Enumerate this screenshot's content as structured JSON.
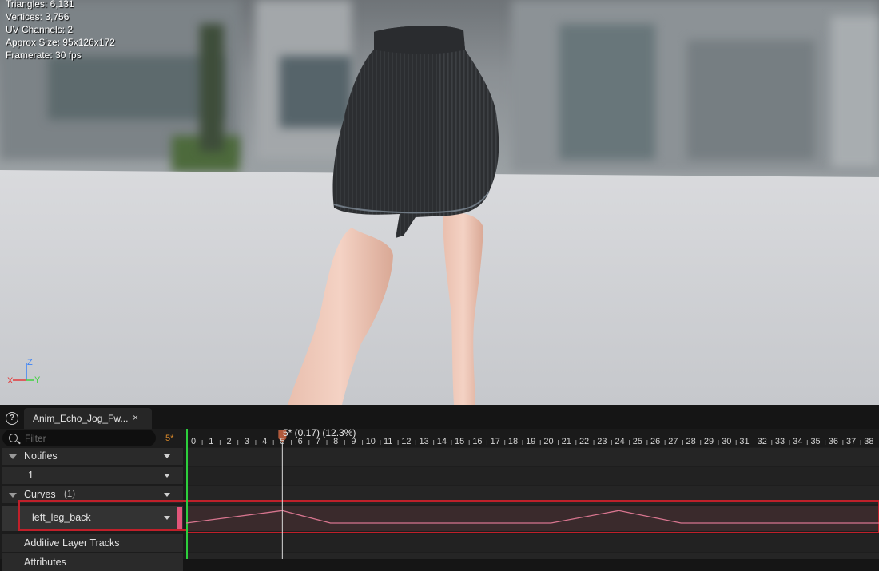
{
  "viewport": {
    "stats": [
      "Triangles: 6,131",
      "Vertices: 3,756",
      "UV Channels: 2",
      "Approx Size: 95x126x172",
      "Framerate: 30 fps"
    ],
    "axis": {
      "z": "Z",
      "y": "Y",
      "x": "X",
      "z_color": "#3b82f6",
      "y_color": "#3fd33f",
      "x_color": "#e23b3b"
    }
  },
  "panel": {
    "help_label": "?",
    "tab_title": "Anim_Echo_Jog_Fw...",
    "tab_close": "×",
    "search": {
      "placeholder": "Filter",
      "value": ""
    },
    "frame_badge": "5*",
    "notifies": {
      "label": "Notifies",
      "value": "1"
    },
    "curves": {
      "label": "Curves",
      "count": "(1)"
    },
    "curve_item": {
      "name": "left_leg_back",
      "color": "#e0567a"
    },
    "additive_label": "Additive Layer Tracks",
    "attributes_label": "Attributes"
  },
  "timeline": {
    "scrub_label": "5* (0.17) (12.3%)",
    "current_frame": 5,
    "ticks": [
      "0",
      "1",
      "2",
      "3",
      "4",
      "5",
      "6",
      "7",
      "8",
      "9",
      "10",
      "11",
      "12",
      "13",
      "14",
      "15",
      "16",
      "17",
      "18",
      "19",
      "20",
      "21",
      "22",
      "23",
      "24",
      "25",
      "26",
      "27",
      "28",
      "29",
      "30",
      "31",
      "32",
      "33",
      "34",
      "35",
      "36",
      "37",
      "38"
    ],
    "curve_color": "#d8758f",
    "highlight_color": "#c0202a"
  }
}
